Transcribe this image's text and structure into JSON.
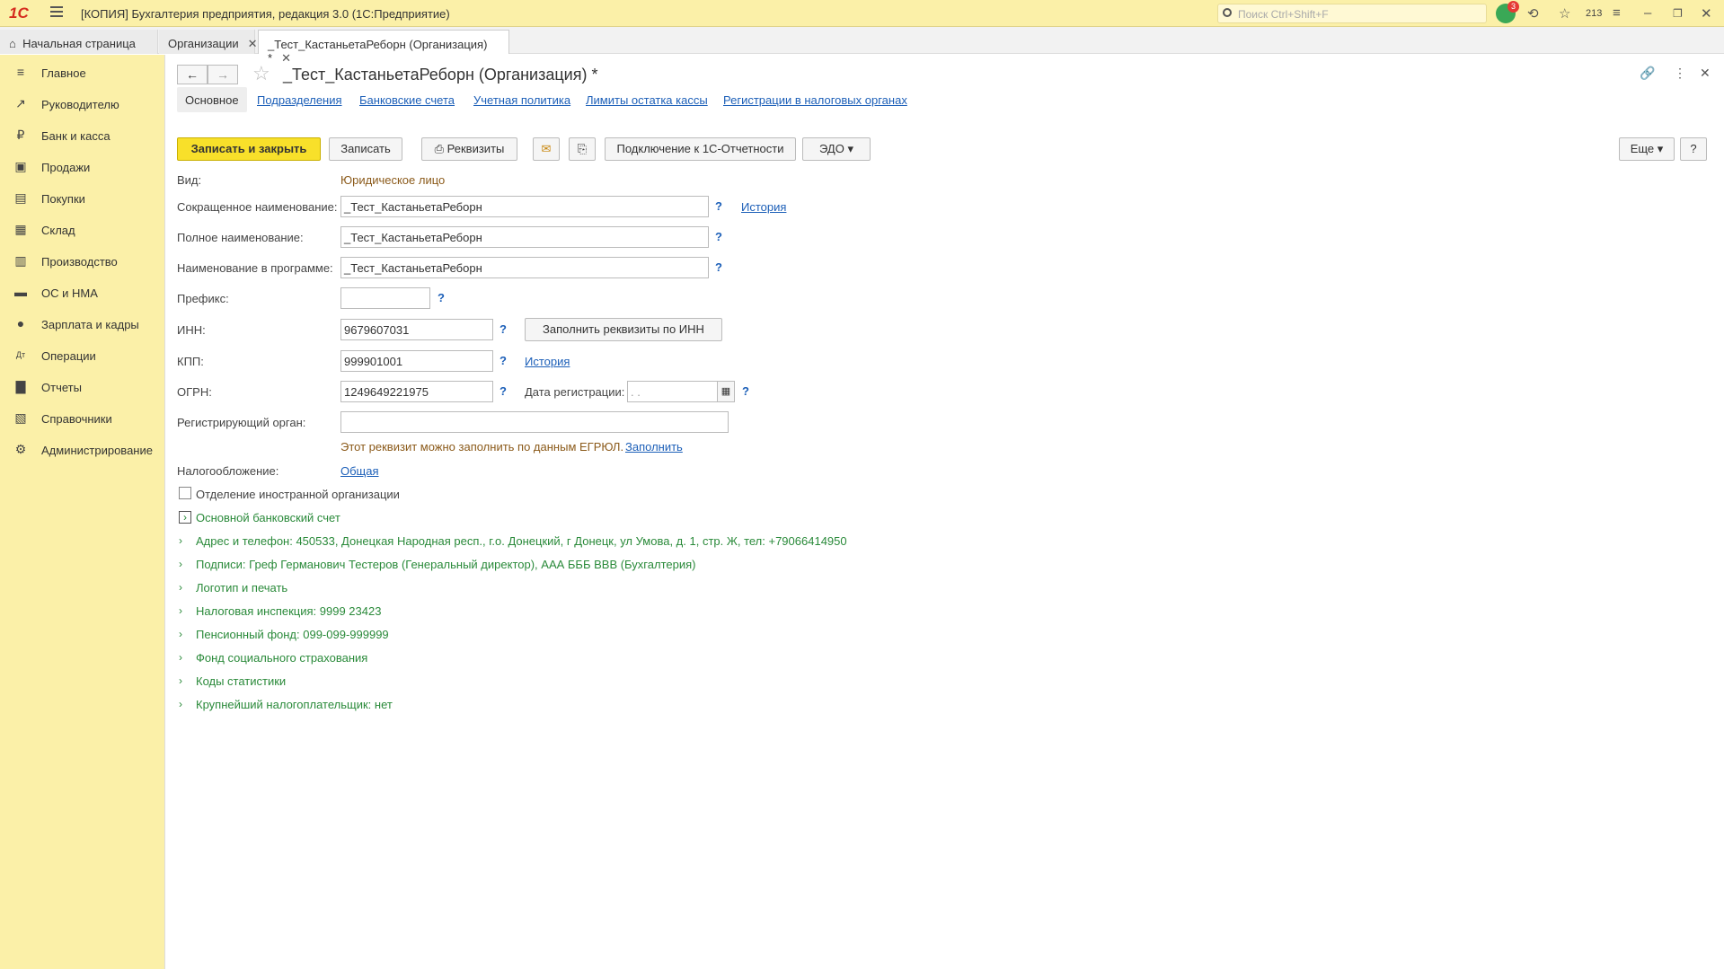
{
  "window": {
    "logo": "1С",
    "title": "[КОПИЯ] Бухгалтерия предприятия, редакция 3.0  (1С:Предприятие)",
    "search_placeholder": "Поиск Ctrl+Shift+F",
    "notifications": "3",
    "counter": "213"
  },
  "tabs": [
    {
      "label": "Начальная страница"
    },
    {
      "label": "Организации"
    },
    {
      "label": "_Тест_КастаньетаРеборн (Организация) *"
    }
  ],
  "sidebar": {
    "items": [
      {
        "label": "Главное",
        "icon": "menu-icon"
      },
      {
        "label": "Руководителю",
        "icon": "trend-icon"
      },
      {
        "label": "Банк и касса",
        "icon": "ruble-icon"
      },
      {
        "label": "Продажи",
        "icon": "bag-icon"
      },
      {
        "label": "Покупки",
        "icon": "cart-icon"
      },
      {
        "label": "Склад",
        "icon": "warehouse-icon"
      },
      {
        "label": "Производство",
        "icon": "factory-icon"
      },
      {
        "label": "ОС и НМА",
        "icon": "truck-icon"
      },
      {
        "label": "Зарплата и кадры",
        "icon": "person-icon"
      },
      {
        "label": "Операции",
        "icon": "dtkt-icon"
      },
      {
        "label": "Отчеты",
        "icon": "chart-icon"
      },
      {
        "label": "Справочники",
        "icon": "book-icon"
      },
      {
        "label": "Администрирование",
        "icon": "gear-icon"
      }
    ]
  },
  "form": {
    "title": "_Тест_КастаньетаРеборн (Организация) *",
    "subtabs": [
      "Основное",
      "Подразделения",
      "Банковские счета",
      "Учетная политика",
      "Лимиты остатка кассы",
      "Регистрации в налоговых органах"
    ],
    "toolbar": {
      "save_close": "Записать и закрыть",
      "save": "Записать",
      "requisites": "Реквизиты",
      "connect": "Подключение к 1С-Отчетности",
      "edo": "ЭДО",
      "more": "Еще",
      "help": "?"
    },
    "fields": {
      "kind_label": "Вид:",
      "kind_value": "Юридическое лицо",
      "short_name_label": "Сокращенное наименование:",
      "short_name": "_Тест_КастаньетаРеборн",
      "full_name_label": "Полное наименование:",
      "full_name": "_Тест_КастаньетаРеборн",
      "program_name_label": "Наименование в программе:",
      "program_name": "_Тест_КастаньетаРеборн",
      "prefix_label": "Префикс:",
      "prefix": "",
      "inn_label": "ИНН:",
      "inn": "9679607031",
      "fill_by_inn": "Заполнить реквизиты по ИНН",
      "kpp_label": "КПП:",
      "kpp": "999901001",
      "ogrn_label": "ОГРН:",
      "ogrn": "1249649221975",
      "reg_date_label": "Дата регистрации:",
      "reg_date": " .  .",
      "reg_organ_label": "Регистрирующий орган:",
      "reg_organ": "",
      "egrul_hint": "Этот реквизит можно заполнить по данным ЕГРЮЛ.",
      "egrul_fill": "Заполнить",
      "taxation_label": "Налогообложение:",
      "taxation": "Общая",
      "history": "История",
      "foreign_branch": "Отделение иностранной организации"
    },
    "groups": [
      "Основной банковский счет",
      "Адрес и телефон: 450533, Донецкая Народная респ., г.о. Донецкий, г Донецк, ул Умова, д. 1, стр. Ж, тел: +79066414950",
      "Подписи: Греф Германович Тестеров (Генеральный директор), ААА БББ ВВВ (Бухгалтерия)",
      "Логотип и печать",
      "Налоговая инспекция: 9999 23423",
      "Пенсионный фонд: 099-099-999999",
      "Фонд социального страхования",
      "Коды статистики",
      "Крупнейший налогоплательщик: нет"
    ]
  }
}
